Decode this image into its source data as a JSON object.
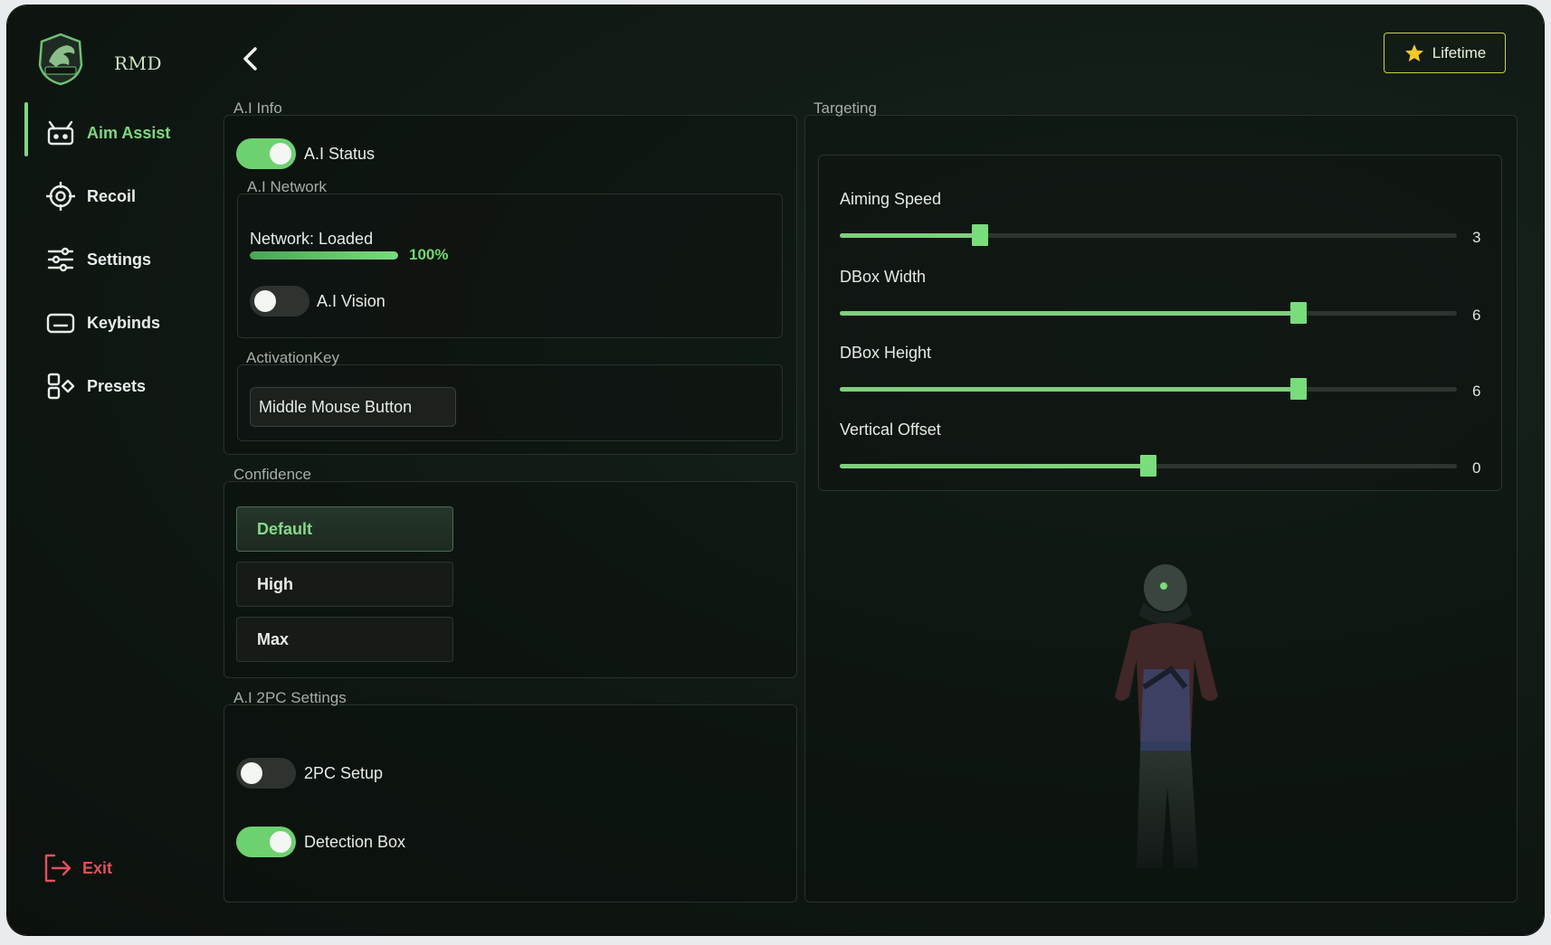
{
  "app": {
    "brand": "RMD",
    "logo_icon": "dragon-emblem-icon"
  },
  "sidebar": {
    "items": [
      {
        "label": "Aim Assist",
        "icon": "robot-icon",
        "active": true
      },
      {
        "label": "Recoil",
        "icon": "crosshair-icon",
        "active": false
      },
      {
        "label": "Settings",
        "icon": "sliders-icon",
        "active": false
      },
      {
        "label": "Keybinds",
        "icon": "keyboard-icon",
        "active": false
      },
      {
        "label": "Presets",
        "icon": "shapes-icon",
        "active": false
      }
    ],
    "exit_label": "Exit"
  },
  "header": {
    "badge_label": "Lifetime",
    "badge_icon": "star-icon"
  },
  "ai_info": {
    "title": "A.I Info",
    "status_label": "A.I Status",
    "status_on": true,
    "network": {
      "title": "A.I Network",
      "status_text": "Network: Loaded",
      "progress": 100,
      "progress_text": "100%",
      "vision_label": "A.I Vision",
      "vision_on": false
    },
    "activation": {
      "title": "ActivationKey",
      "value": "Middle Mouse Button"
    }
  },
  "confidence": {
    "title": "Confidence",
    "options": [
      "Default",
      "High",
      "Max"
    ],
    "selected": "Default"
  },
  "two_pc": {
    "title": "A.I 2PC Settings",
    "setup_label": "2PC Setup",
    "setup_on": false,
    "detection_label": "Detection Box",
    "detection_on": true
  },
  "targeting": {
    "title": "Targeting",
    "sliders": [
      {
        "label": "Aiming Speed",
        "value": "3",
        "fraction": 0.228
      },
      {
        "label": "DBox Width",
        "value": "6",
        "fraction": 0.743
      },
      {
        "label": "DBox Height",
        "value": "6",
        "fraction": 0.743
      },
      {
        "label": "Vertical Offset",
        "value": "0",
        "fraction": 0.5
      }
    ]
  },
  "colors": {
    "accent": "#78dd7a",
    "exit": "#e0505a",
    "badge_border": "#c9d34a"
  }
}
